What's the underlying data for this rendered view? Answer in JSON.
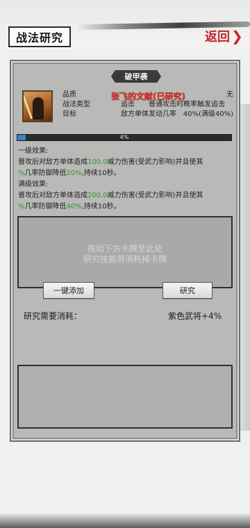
{
  "header": {
    "title": "战法研究",
    "back_label": "返回",
    "back_icon": "chevron-right"
  },
  "skill": {
    "name": "破甲袭",
    "overlay": "张飞的文献(已研究)",
    "rows": [
      {
        "k1": "品质",
        "v1": "",
        "k2": "",
        "v2": "无"
      },
      {
        "k1": "战法类型",
        "v1": "追击",
        "k2": "普通攻击时概率触发追击",
        "v2": ""
      },
      {
        "k1": "目标",
        "v1": "敌方单体",
        "k2": "发动几率",
        "v2": "40%(满级40%)"
      }
    ]
  },
  "progress": {
    "value": 0.04,
    "label": "4%",
    "fill_color": "#3f7fd0"
  },
  "effects": {
    "level1_title": "一级效果:",
    "level1_a": "普攻后对敌方单体造成",
    "level1_v1": "100.0",
    "level1_b": "威力伤害(受武力影响)并且使其",
    "level1_pct": "%",
    "level1_c": "几率防御降低",
    "level1_v2": "20%",
    "level1_d": ",持续10秒。",
    "max_title": "满级效果:",
    "max_a": "普攻后对敌方单体造成",
    "max_v1": "200.0",
    "max_b": "威力伤害(受武力影响)并且使其",
    "max_pct": "%",
    "max_c": "几率防御降低",
    "max_v2": "40%",
    "max_d": ",持续10秒。",
    "highlight_color": "#2a9a2a"
  },
  "drop_area": {
    "hint_line1": "拖动下方卡牌至此处",
    "hint_line2": "研究技能将消耗掉卡牌"
  },
  "buttons": {
    "add_all": "一键添加",
    "research": "研究"
  },
  "cost": {
    "label": "研究需要消耗：",
    "value": "紫色武将+4%"
  }
}
